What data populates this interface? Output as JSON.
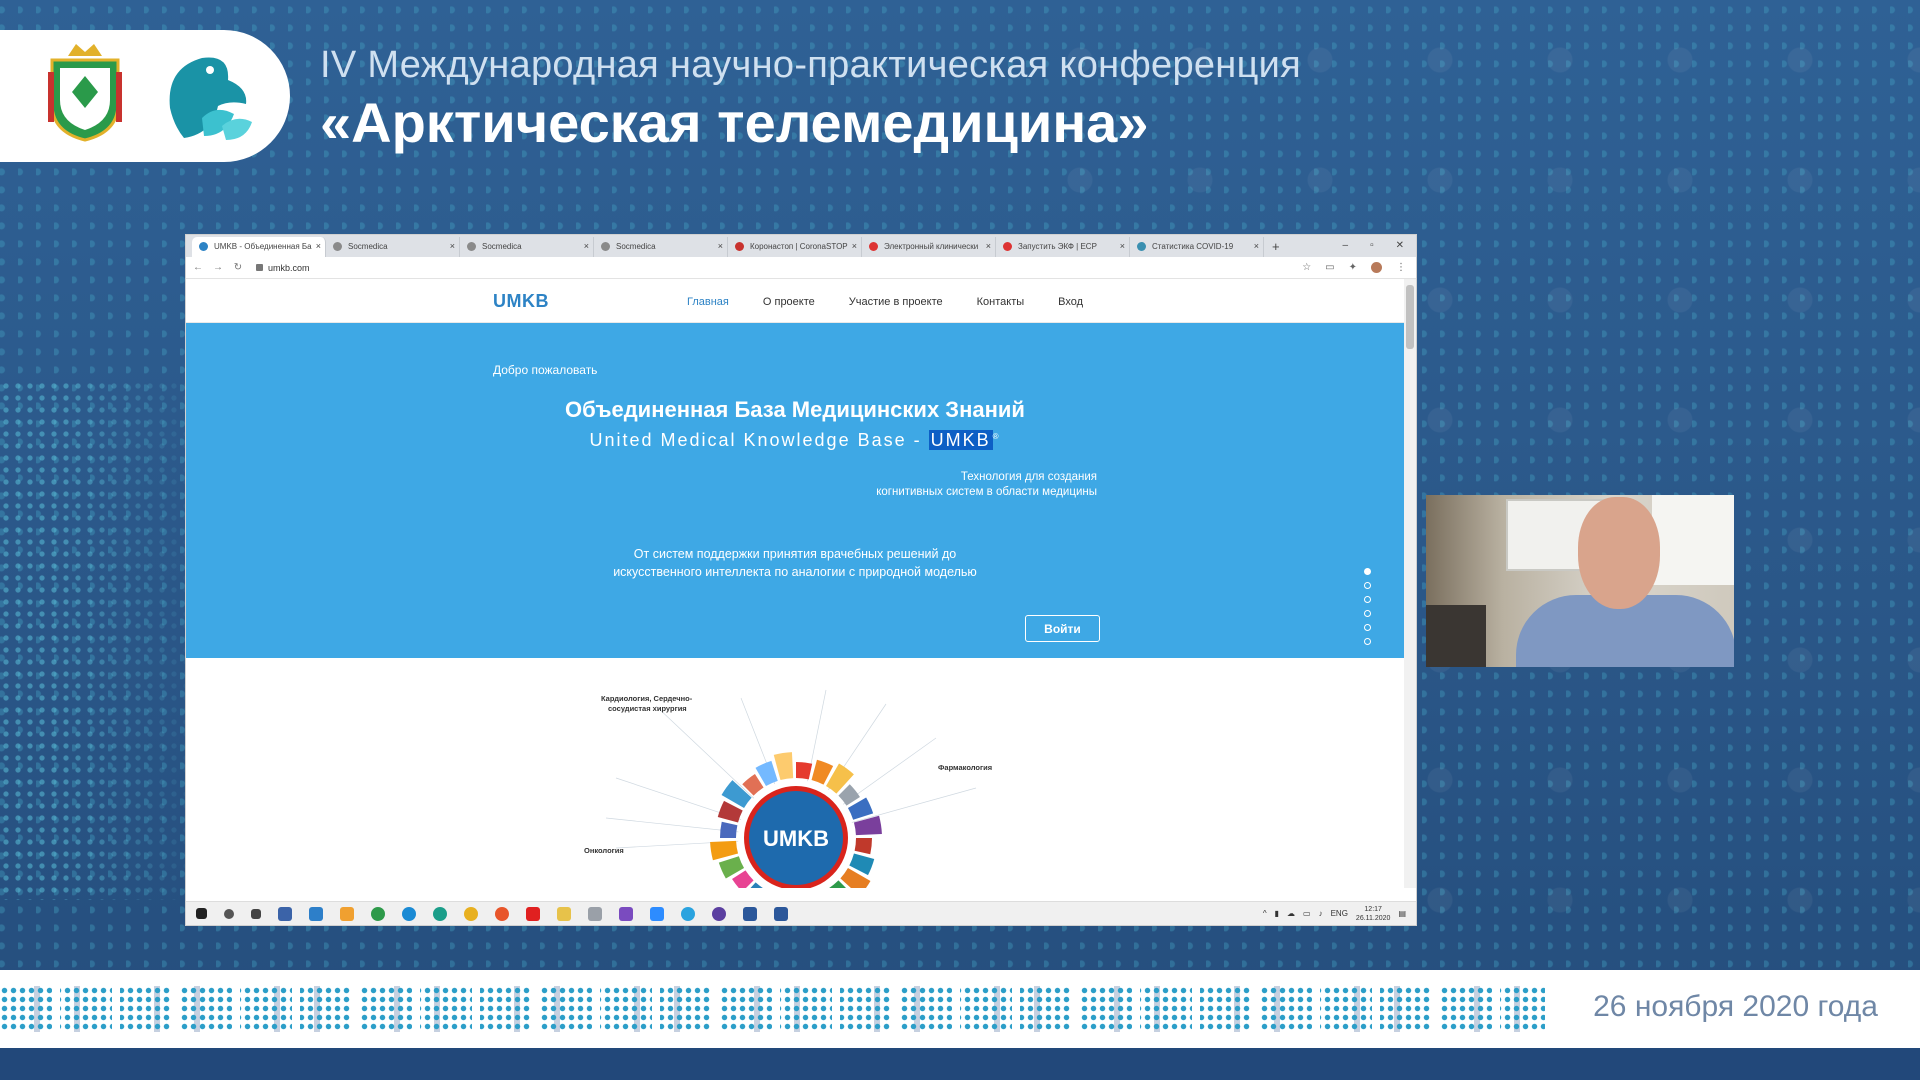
{
  "conference": {
    "subtitle": "IV Международная научно-практическая конференция",
    "title": "«Арктическая телемедицина»",
    "date": "26 ноября 2020 года"
  },
  "browser": {
    "tabs": [
      {
        "label": "UMKB - Объединенная Ба",
        "active": true
      },
      {
        "label": "Socmedica"
      },
      {
        "label": "Socmedica"
      },
      {
        "label": "Socmedica"
      },
      {
        "label": "Коронастоп | CoronaSTOP"
      },
      {
        "label": "Электронный клинически"
      },
      {
        "label": "Запустить ЭКФ | ЕСР"
      },
      {
        "label": "Статистика COVID-19"
      }
    ],
    "new_tab": "+",
    "url": "umkb.com"
  },
  "site": {
    "brand": "UMKB",
    "menu": [
      "Главная",
      "О проекте",
      "Участие в проекте",
      "Контакты",
      "Вход"
    ],
    "welcome": "Добро пожаловать",
    "hero_title": "Объединенная База Медицинских Знаний",
    "hero_sub_prefix": "United Medical Knowledge Base - ",
    "hero_sub_highlight": "UMKB",
    "hero_sub_reg": "®",
    "tech_line1": "Технология для создания",
    "tech_line2": "когнитивных систем в области медицины",
    "desc_line1": "От систем поддержки принятия врачебных решений до",
    "desc_line2": "искусственного интеллекта по аналогии с природной моделью",
    "enter_button": "Войти",
    "wheel_center": "UMKB",
    "wheel_labels": [
      {
        "text": "Кардиология, Сердечно-",
        "dark": true
      },
      {
        "text": "сосудистая хирургия",
        "dark": true
      },
      {
        "text": "Фармакология",
        "dark": true
      },
      {
        "text": "Онкология",
        "dark": true
      }
    ]
  },
  "taskbar": {
    "lang": "ENG",
    "time": "12:17",
    "date": "26.11.2020"
  },
  "colors": {
    "site_accent": "#2d83c5",
    "hero_bg": "#3ea8e5",
    "slide_bg": "#2a5a8c"
  }
}
